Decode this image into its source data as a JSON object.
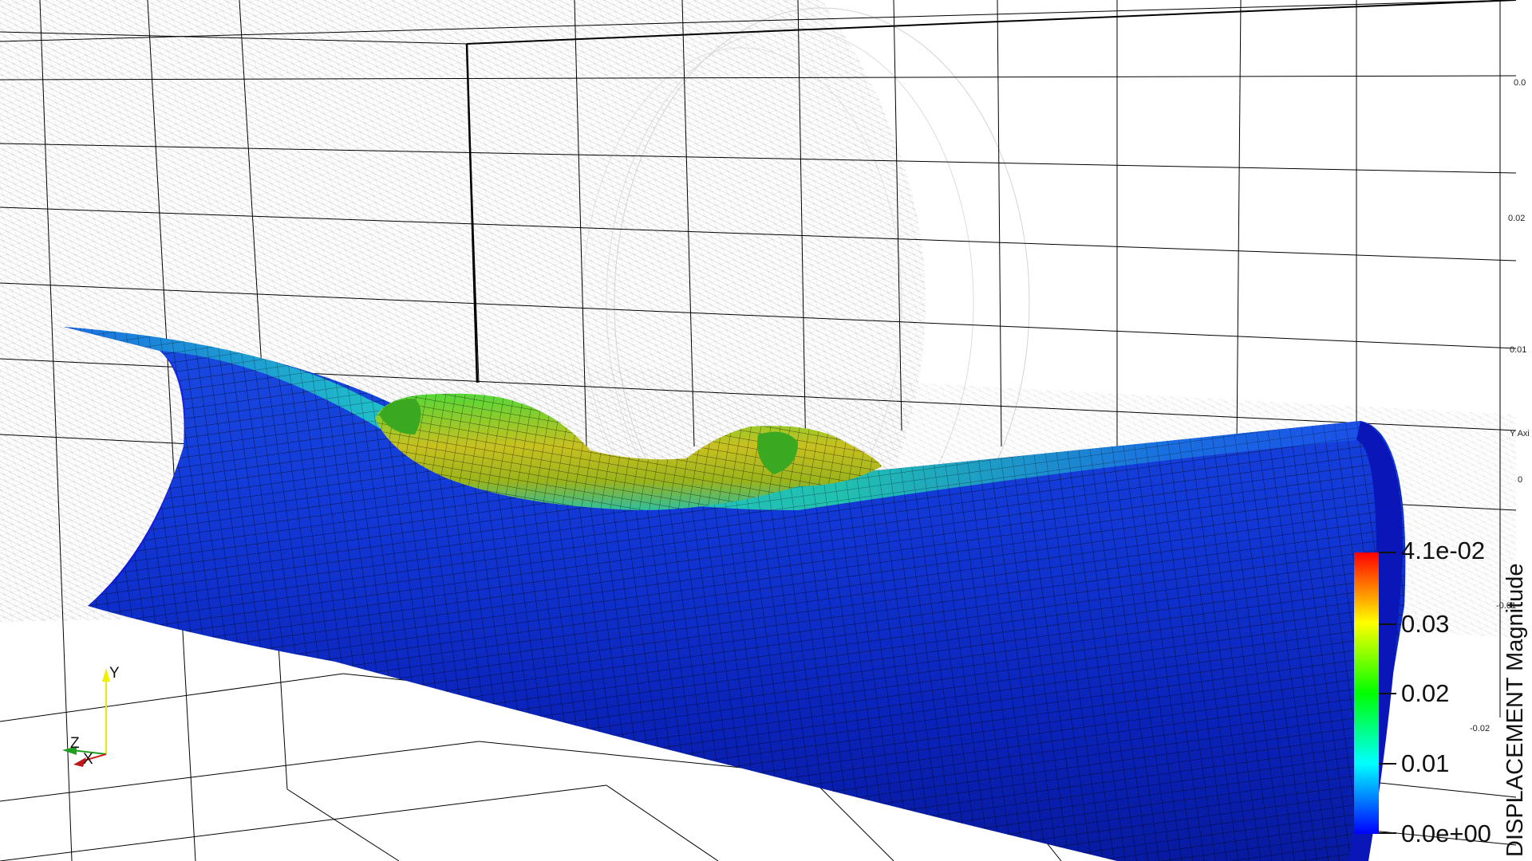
{
  "viewer": {
    "y_axis": {
      "title": "Y Axi",
      "tick_labels": [
        "0.0",
        "0.02",
        "0.01",
        "0",
        "-0.01",
        "-0.02"
      ]
    },
    "orientation_axes": {
      "labels": [
        "Y",
        "Z",
        "X"
      ]
    },
    "colorbar": {
      "title": "DISPLACEMENT Magnitude",
      "labels": [
        "4.1e-02",
        "0.03",
        "0.02",
        "0.01",
        "0.0e+00"
      ],
      "range": [
        0.0,
        0.041
      ],
      "colormap": [
        "#0000ff",
        "#00ffff",
        "#00ff00",
        "#ffff00",
        "#ff0000"
      ]
    },
    "colors": {
      "background": "#ffffff",
      "grid": "#000000",
      "mesh_low": "#0a0ad8",
      "mesh_mid": "#18b6cc",
      "mesh_high": "#e0b000"
    }
  }
}
